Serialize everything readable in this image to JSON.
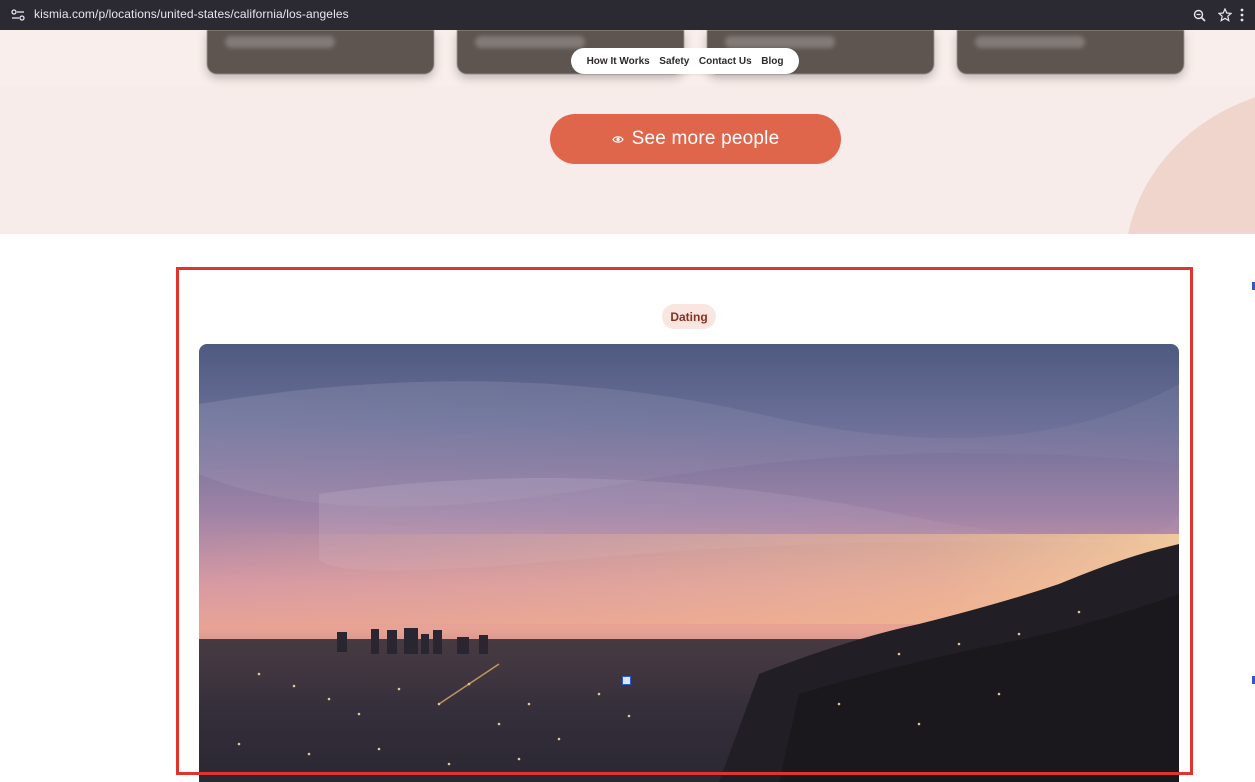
{
  "browser": {
    "url": "kismia.com/p/locations/united-states/california/los-angeles",
    "icons": [
      "site-settings-icon",
      "zoom-icon",
      "bookmark-star-icon",
      "menu-kebab-icon"
    ]
  },
  "nav": {
    "items": [
      {
        "label": "How It Works"
      },
      {
        "label": "Safety"
      },
      {
        "label": "Contact Us"
      },
      {
        "label": "Blog"
      }
    ]
  },
  "cta": {
    "label": "See more people",
    "icon": "eye-icon",
    "color": "#df654b"
  },
  "article": {
    "tag": "Dating",
    "image": "los-angeles-sunset-skyline"
  },
  "colors": {
    "band": "#f7ece9",
    "highlight": "#e0352f",
    "tag_bg": "#f9e6e1",
    "tag_text": "#8a2f22"
  }
}
